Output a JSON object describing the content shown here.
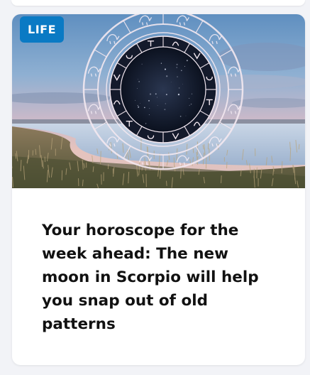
{
  "previous_card": {},
  "article_card": {
    "category_badge": "LIFE",
    "headline": "Your horoscope for the week ahead: The new moon in Scorpio will help you snap out of old patterns",
    "image": {
      "subject": "zodiac-wheel-over-coastal-sunset"
    }
  },
  "colors": {
    "page_background": "#f2f3f7",
    "card_background": "#ffffff",
    "badge_background": "#0a7ac4",
    "badge_text": "#ffffff",
    "headline_text": "#111111"
  }
}
